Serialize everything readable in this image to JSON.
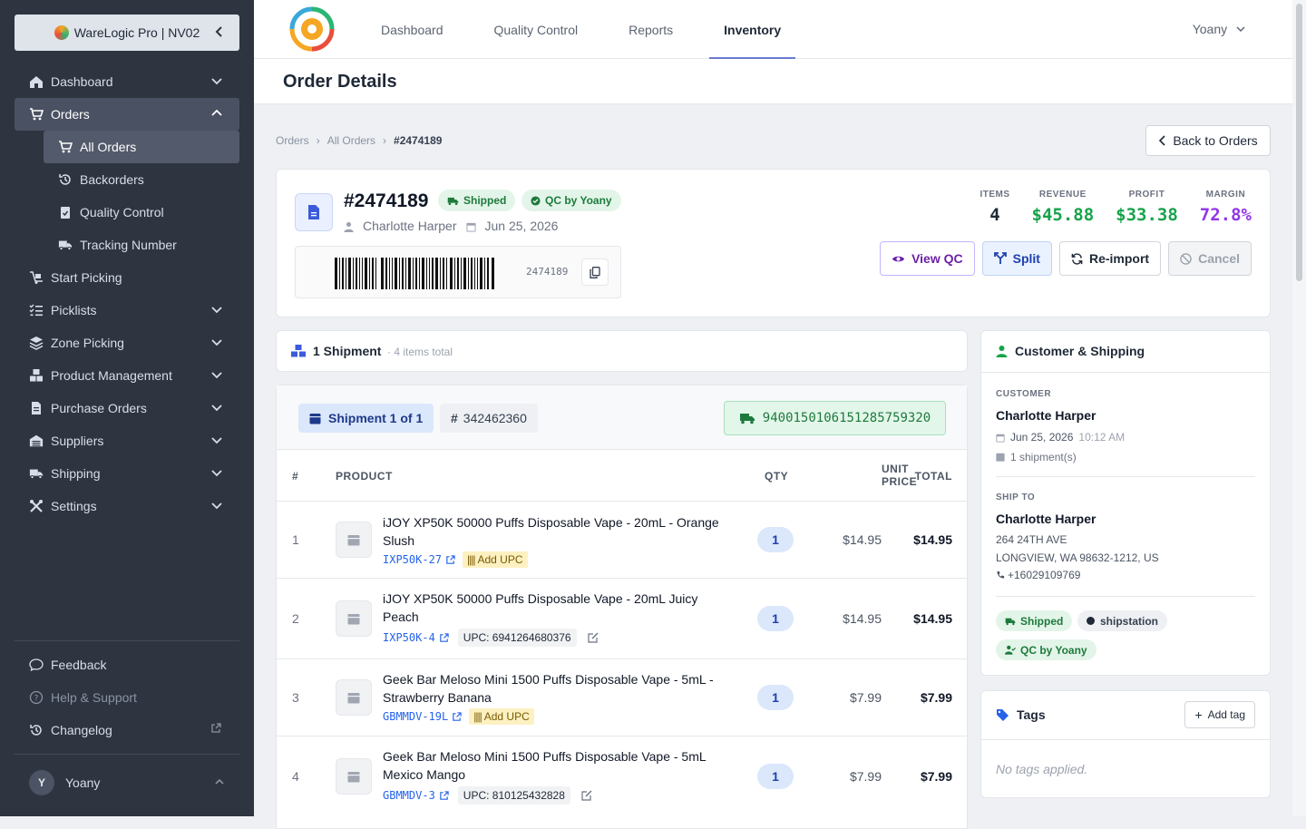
{
  "app": {
    "brand": "WareLogic Pro | NV02"
  },
  "sidebar": {
    "items": [
      {
        "label": "Dashboard"
      },
      {
        "label": "Orders"
      },
      {
        "label": "Start Picking"
      },
      {
        "label": "Picklists"
      },
      {
        "label": "Zone Picking"
      },
      {
        "label": "Product Management"
      },
      {
        "label": "Purchase Orders"
      },
      {
        "label": "Suppliers"
      },
      {
        "label": "Shipping"
      },
      {
        "label": "Settings"
      }
    ],
    "orders_sub": [
      {
        "label": "All Orders"
      },
      {
        "label": "Backorders"
      },
      {
        "label": "Quality Control"
      },
      {
        "label": "Tracking Number"
      }
    ],
    "bottom": [
      {
        "label": "Feedback"
      },
      {
        "label": "Help & Support"
      },
      {
        "label": "Changelog"
      }
    ],
    "user": {
      "initial": "Y",
      "name": "Yoany"
    }
  },
  "topnav": {
    "tabs": [
      {
        "label": "Dashboard"
      },
      {
        "label": "Quality Control"
      },
      {
        "label": "Reports"
      },
      {
        "label": "Inventory"
      }
    ],
    "user": "Yoany"
  },
  "page": {
    "title": "Order Details"
  },
  "breadcrumb": {
    "items": [
      "Orders",
      "All Orders",
      "#2474189"
    ]
  },
  "back_button": "Back to Orders",
  "order": {
    "number": "#2474189",
    "status_badge": "Shipped",
    "qc_badge": "QC by Yoany",
    "customer": "Charlotte Harper",
    "date": "Jun 25, 2026",
    "barcode_text": "2474189",
    "stats": [
      {
        "label": "ITEMS",
        "value": "4",
        "color": "#1f2937"
      },
      {
        "label": "REVENUE",
        "value": "$45.88",
        "color": "#16a34a"
      },
      {
        "label": "PROFIT",
        "value": "$33.38",
        "color": "#16a34a"
      },
      {
        "label": "MARGIN",
        "value": "72.8%",
        "color": "#9333ea"
      }
    ],
    "actions": {
      "view_qc": "View QC",
      "split": "Split",
      "reimport": "Re-import",
      "cancel": "Cancel"
    }
  },
  "shipments": {
    "title": "1 Shipment",
    "subtitle": "· 4 items total",
    "shipment_label": "Shipment 1 of 1",
    "shipment_id": "342462360",
    "tracking": "9400150106151285759320",
    "columns": {
      "num": "#",
      "product": "PRODUCT",
      "qty": "QTY",
      "unit1": "UNIT",
      "unit2": "PRICE",
      "total": "TOTAL"
    },
    "rows": [
      {
        "num": "1",
        "name": "iJOY XP50K 50000 Puffs Disposable Vape - 20mL - Orange Slush",
        "sku": "IXP50K-27",
        "upc": "",
        "add_upc": "Add UPC",
        "qty": "1",
        "unit_price": "$14.95",
        "total": "$14.95"
      },
      {
        "num": "2",
        "name": "iJOY XP50K 50000 Puffs Disposable Vape - 20mL Juicy Peach",
        "sku": "IXP50K-4",
        "upc": "UPC: 6941264680376",
        "add_upc": "",
        "qty": "1",
        "unit_price": "$14.95",
        "total": "$14.95"
      },
      {
        "num": "3",
        "name": "Geek Bar Meloso Mini 1500 Puffs Disposable Vape - 5mL - Strawberry Banana",
        "sku": "GBMMDV-19L",
        "upc": "",
        "add_upc": "Add UPC",
        "qty": "1",
        "unit_price": "$7.99",
        "total": "$7.99"
      },
      {
        "num": "4",
        "name": "Geek Bar Meloso Mini 1500 Puffs Disposable Vape - 5mL Mexico Mango",
        "sku": "GBMMDV-3",
        "upc": "UPC: 810125432828",
        "add_upc": "",
        "qty": "1",
        "unit_price": "$7.99",
        "total": "$7.99"
      }
    ]
  },
  "customer_panel": {
    "title": "Customer & Shipping",
    "customer_label": "CUSTOMER",
    "customer_name": "Charlotte Harper",
    "order_date": "Jun 25, 2026",
    "order_time": "10:12 AM",
    "shipments_count": "1 shipment(s)",
    "ship_to_label": "SHIP TO",
    "ship_name": "Charlotte Harper",
    "address1": "264 24TH AVE",
    "address2": "LONGVIEW, WA 98632-1212, US",
    "phone": "+16029109769",
    "tags": [
      "Shipped",
      "shipstation",
      "QC by Yoany"
    ]
  },
  "tags_panel": {
    "title": "Tags",
    "add_label": "Add tag",
    "empty": "No tags applied."
  }
}
